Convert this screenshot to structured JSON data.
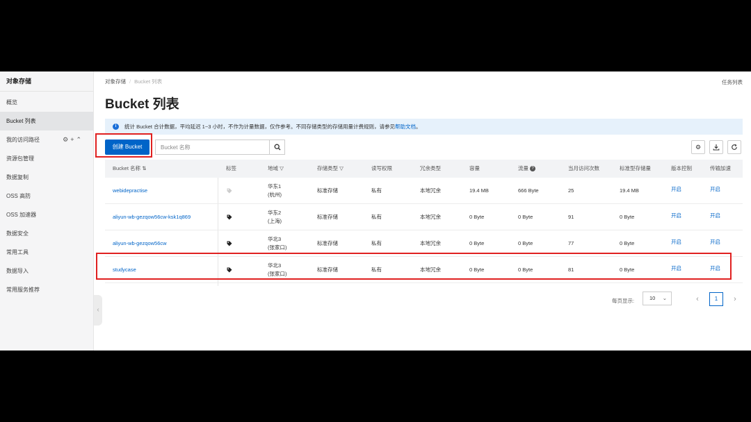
{
  "sidebar": {
    "title": "对象存储",
    "items": [
      {
        "label": "概览"
      },
      {
        "label": "Bucket 列表"
      },
      {
        "label": "我的访问路径"
      },
      {
        "label": "资源包管理"
      },
      {
        "label": "数据复制"
      },
      {
        "label": "OSS 高防"
      },
      {
        "label": "OSS 加速器"
      },
      {
        "label": "数据安全"
      },
      {
        "label": "常用工具"
      },
      {
        "label": "数据导入"
      },
      {
        "label": "常用服务推荐"
      }
    ]
  },
  "breadcrumb": {
    "root": "对象存储",
    "current": "Bucket 列表"
  },
  "header": {
    "task_list": "任务列表",
    "title": "Bucket 列表"
  },
  "notice": {
    "text": "统计 Bucket 合计数据，平均延迟 1~3 小时，不作为计量数据，仅作参考。不同存储类型的存储用量计费规则，请参见",
    "link": "帮助文档",
    "end": "。"
  },
  "toolbar": {
    "create_label": "创建 Bucket",
    "search_placeholder": "Bucket 名称"
  },
  "table": {
    "headers": {
      "name": "Bucket 名称",
      "tag": "标签",
      "region": "地域",
      "storage_type": "存储类型",
      "acl": "读写权限",
      "redundancy": "冗余类型",
      "capacity": "容量",
      "traffic": "流量",
      "visits": "当月访问次数",
      "std_storage": "标准型存储量",
      "versioning": "版本控制",
      "acceleration": "传输加速"
    },
    "rows": [
      {
        "name": "webidepractise",
        "region": "华东1",
        "city": "(杭州)",
        "storage_type": "标准存储",
        "acl": "私有",
        "redundancy": "本地冗余",
        "capacity": "19.4 MB",
        "traffic": "666 Byte",
        "visits": "25",
        "std_storage": "19.4 MB",
        "versioning": "开启",
        "acceleration": "开启"
      },
      {
        "name": "aliyun-wb-gezqow56cw-ksk1q869",
        "region": "华东2",
        "city": "(上海)",
        "storage_type": "标准存储",
        "acl": "私有",
        "redundancy": "本地冗余",
        "capacity": "0 Byte",
        "traffic": "0 Byte",
        "visits": "91",
        "std_storage": "0 Byte",
        "versioning": "开启",
        "acceleration": "开启"
      },
      {
        "name": "aliyun-wb-gezqow56cw",
        "region": "华北3",
        "city": "(张家口)",
        "storage_type": "标准存储",
        "acl": "私有",
        "redundancy": "本地冗余",
        "capacity": "0 Byte",
        "traffic": "0 Byte",
        "visits": "77",
        "std_storage": "0 Byte",
        "versioning": "开启",
        "acceleration": "开启"
      },
      {
        "name": "studycase",
        "region": "华北3",
        "city": "(张家口)",
        "storage_type": "标准存储",
        "acl": "私有",
        "redundancy": "本地冗余",
        "capacity": "0 Byte",
        "traffic": "0 Byte",
        "visits": "81",
        "std_storage": "0 Byte",
        "versioning": "开启",
        "acceleration": "开启"
      }
    ]
  },
  "pagination": {
    "page_size_label": "每页显示:",
    "page_size": "10",
    "current_page": "1"
  },
  "colors": {
    "accent": "#0064c8",
    "highlight": "#e02020"
  }
}
